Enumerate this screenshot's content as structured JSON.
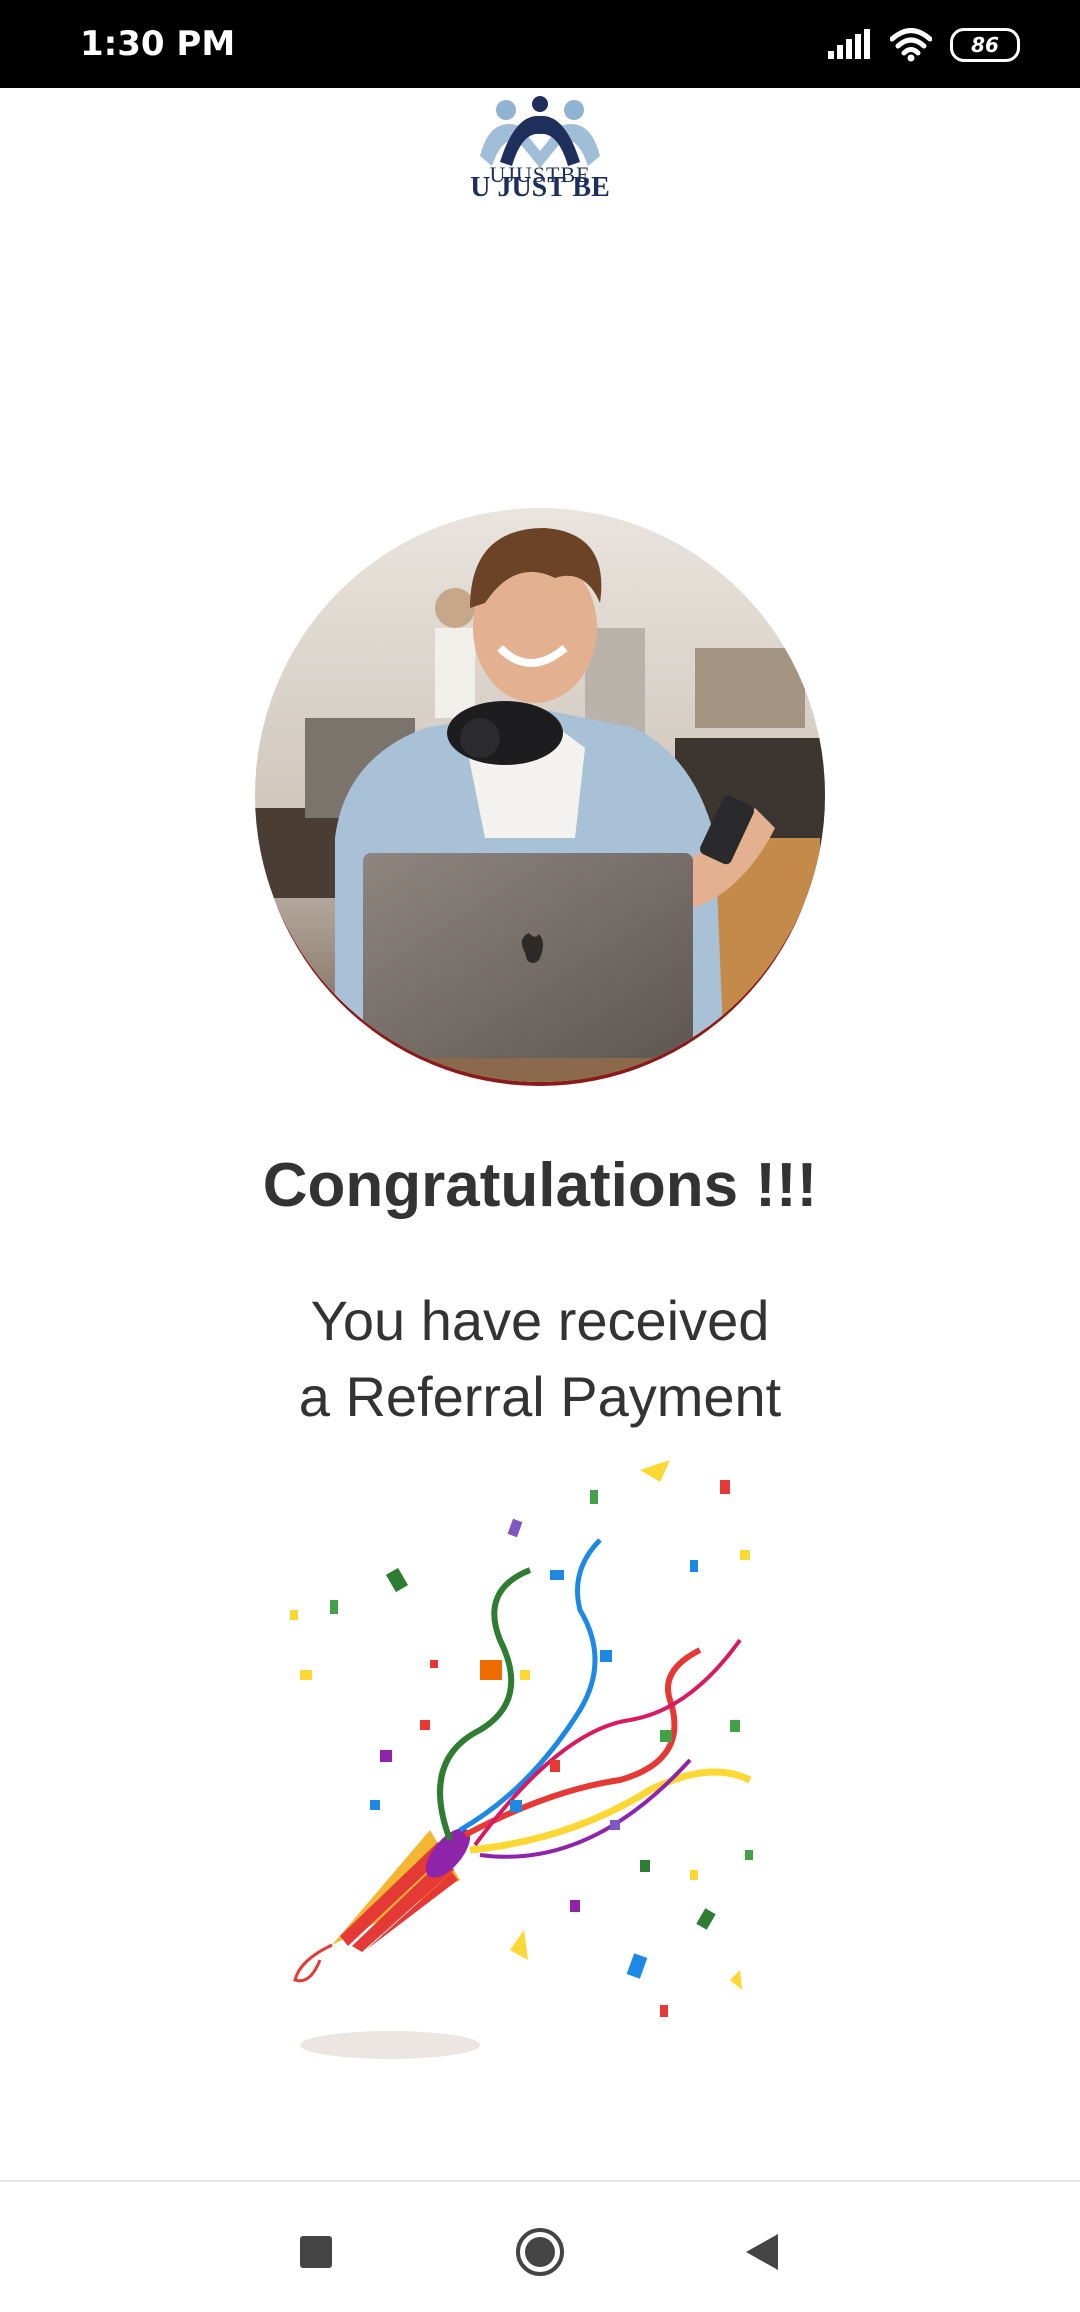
{
  "status_bar": {
    "time": "1:30 PM",
    "battery_level": "86",
    "icons": [
      "signal-icon",
      "wifi-icon",
      "battery-icon"
    ]
  },
  "logo": {
    "line1": "UJUSTBE",
    "line2": "U JUST BE"
  },
  "content": {
    "title": "Congratulations !!!",
    "message_line1": "You have received",
    "message_line2": "a Referral Payment"
  },
  "nav_bar": {
    "icons": [
      "recent-apps-icon",
      "home-icon",
      "back-icon"
    ]
  },
  "colors": {
    "status_bar_bg": "#000000",
    "text": "#333333",
    "logo_navy": "#1f2f5c",
    "logo_light_blue": "#8fb3d1"
  }
}
